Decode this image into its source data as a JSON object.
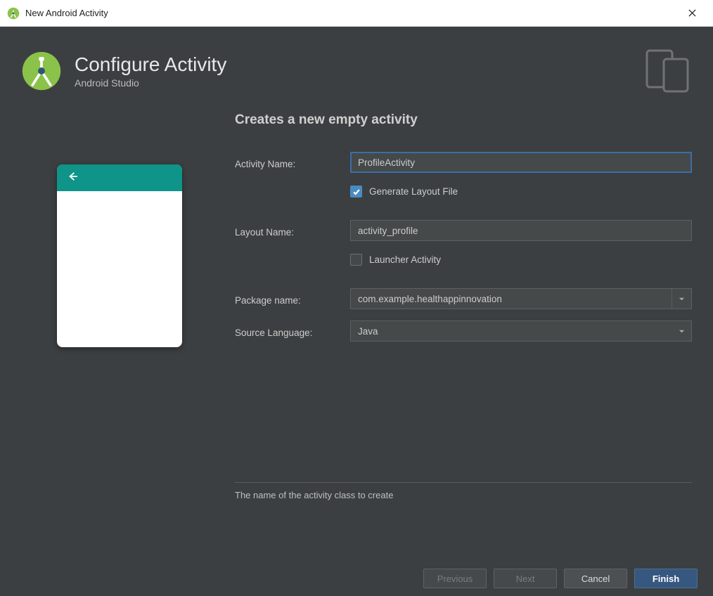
{
  "window": {
    "title": "New Android Activity"
  },
  "header": {
    "title": "Configure Activity",
    "subtitle": "Android Studio"
  },
  "section": {
    "heading": "Creates a new empty activity",
    "hint": "The name of the activity class to create"
  },
  "form": {
    "activity_name": {
      "label": "Activity Name:",
      "value": "ProfileActivity"
    },
    "generate_layout": {
      "label": "Generate Layout File",
      "checked": true
    },
    "layout_name": {
      "label": "Layout Name:",
      "value": "activity_profile"
    },
    "launcher_activity": {
      "label": "Launcher Activity",
      "checked": false
    },
    "package_name": {
      "label": "Package name:",
      "value": "com.example.healthappinnovation"
    },
    "source_language": {
      "label": "Source Language:",
      "value": "Java"
    }
  },
  "footer": {
    "previous": "Previous",
    "next": "Next",
    "cancel": "Cancel",
    "finish": "Finish"
  }
}
